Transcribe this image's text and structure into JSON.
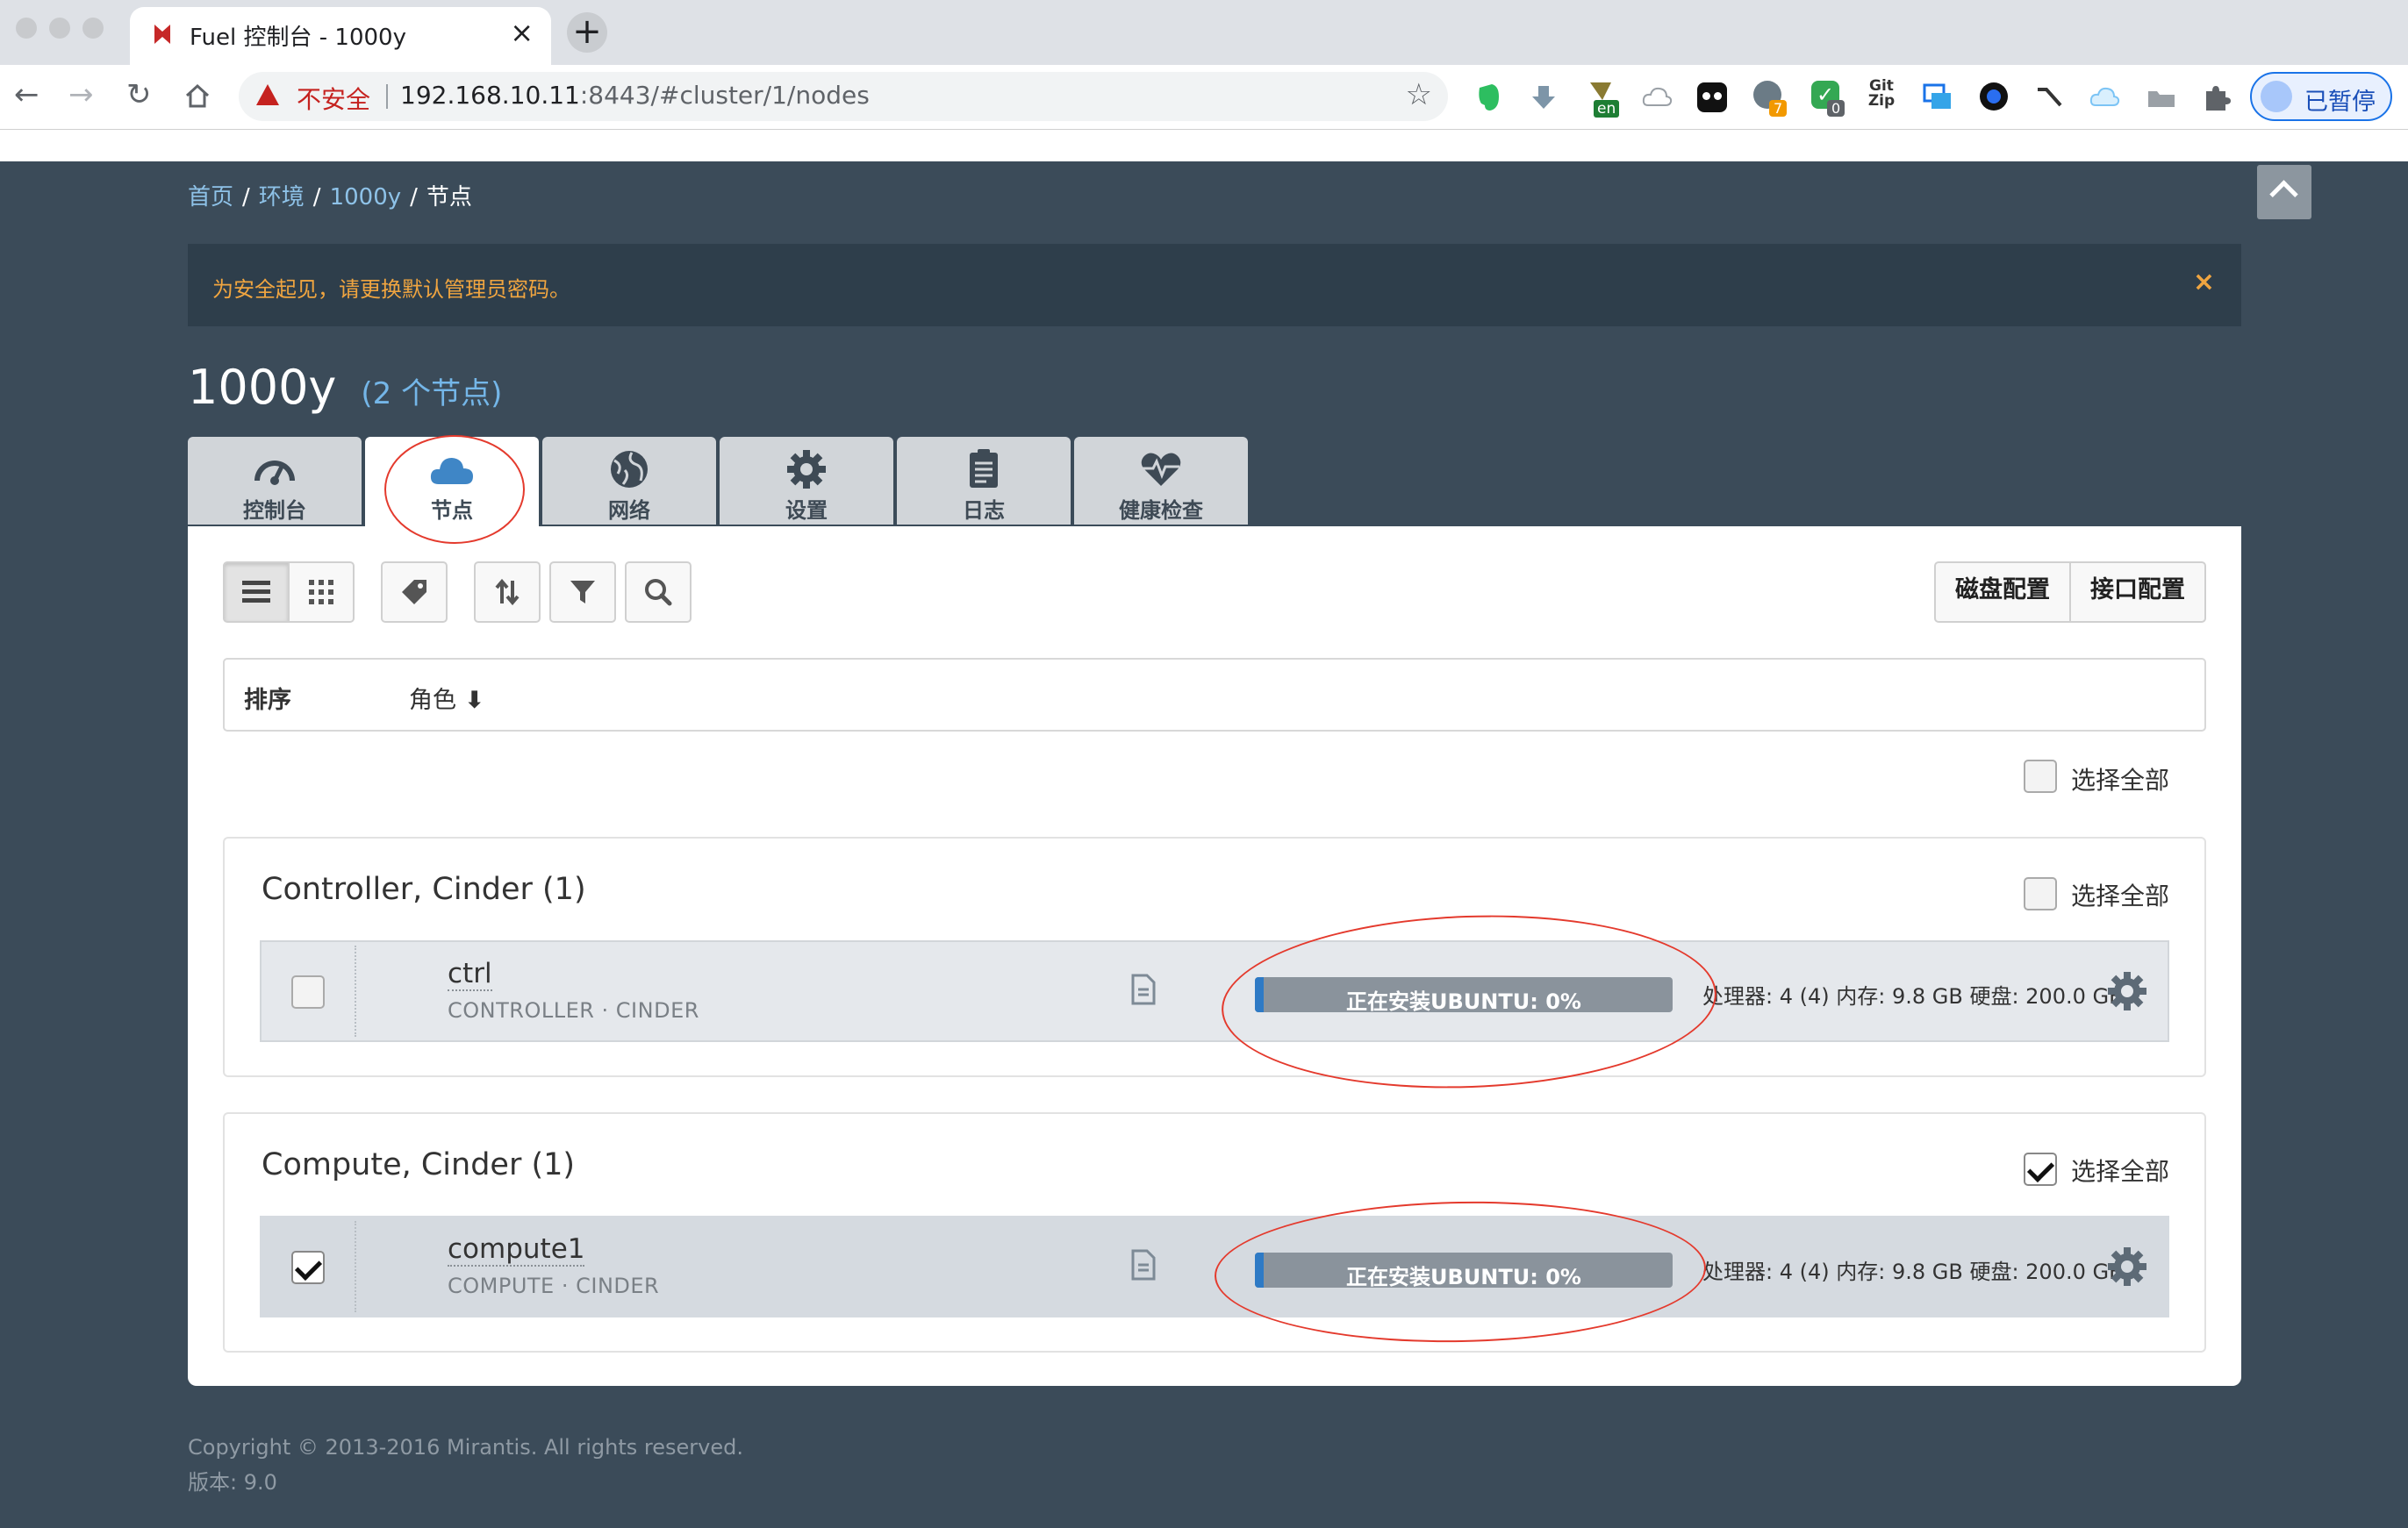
{
  "browser": {
    "tab_title": "Fuel 控制台 - 1000y",
    "security_label": "不安全",
    "url_host": "192.168.10.11",
    "url_rest": ":8443/#cluster/1/nodes",
    "extension_badges": [
      "en",
      "7",
      "0"
    ],
    "gitzip_label": "Git Zip",
    "profile_label": "已暂停"
  },
  "breadcrumb": [
    "首页",
    "环境",
    "1000y",
    "节点"
  ],
  "alert": {
    "text": "为安全起见，请更换默认管理员密码。",
    "close": "×"
  },
  "cluster": {
    "name": "1000y",
    "node_count": "(2 个节点)"
  },
  "tabs": [
    {
      "label": "控制台",
      "icon": "dashboard-icon"
    },
    {
      "label": "节点",
      "icon": "cloud-icon",
      "active": true
    },
    {
      "label": "网络",
      "icon": "network-globe-icon"
    },
    {
      "label": "设置",
      "icon": "gear-icon"
    },
    {
      "label": "日志",
      "icon": "clipboard-icon"
    },
    {
      "label": "健康检查",
      "icon": "heartbeat-icon"
    }
  ],
  "toolbar": {
    "disk_config": "磁盘配置",
    "interface_config": "接口配置"
  },
  "sort": {
    "label": "排序",
    "role": "角色"
  },
  "select_all": "选择全部",
  "groups": [
    {
      "title": "Controller, Cinder (1)",
      "select_all_checked": false,
      "node": {
        "name": "ctrl",
        "roles": "CONTROLLER · CINDER",
        "status": "正在安装UBUNTU: 0%",
        "progress": 0,
        "checked": false,
        "specs": "处理器: 4 (4)  内存: 9.8 GB  硬盘: 200.0 GB"
      }
    },
    {
      "title": "Compute, Cinder (1)",
      "select_all_checked": true,
      "node": {
        "name": "compute1",
        "roles": "COMPUTE · CINDER",
        "status": "正在安装UBUNTU: 0%",
        "progress": 0,
        "checked": true,
        "specs": "处理器: 4 (4)  内存: 9.8 GB  硬盘: 200.0 GB"
      }
    }
  ],
  "footer": {
    "copyright": "Copyright © 2013-2016 Mirantis. All rights reserved.",
    "version": "版本: 9.0"
  },
  "colors": {
    "page_bg": "#3b4b59",
    "alert_text": "#f0a540",
    "link": "#8ec2e8",
    "progress_fill": "#2e7ac5",
    "annotation": "#e43a2d"
  }
}
